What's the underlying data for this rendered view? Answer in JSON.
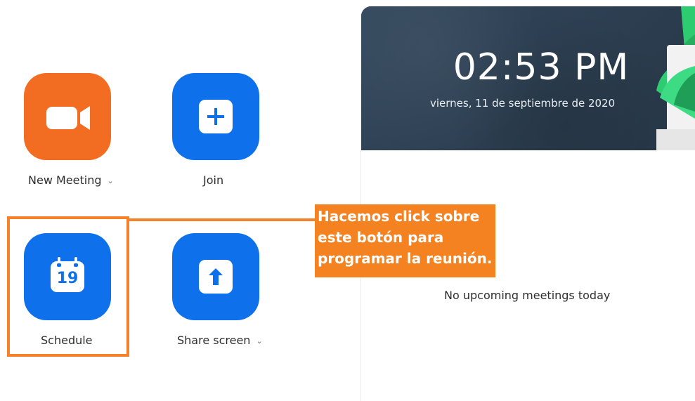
{
  "actions": {
    "new_meeting": {
      "label": "New Meeting",
      "has_dropdown": true,
      "icon": "video-camera-icon",
      "color": "#f26d21"
    },
    "join": {
      "label": "Join",
      "icon": "plus-icon",
      "color": "#0e71eb"
    },
    "schedule": {
      "label": "Schedule",
      "icon": "calendar-icon",
      "calendar_day": "19",
      "color": "#0e71eb"
    },
    "share_screen": {
      "label": "Share screen",
      "has_dropdown": true,
      "icon": "up-arrow-icon",
      "color": "#0e71eb"
    }
  },
  "clock": {
    "time": "02:53 PM",
    "date": "viernes, 11 de septiembre de 2020"
  },
  "meetings": {
    "empty_message": "No upcoming meetings today"
  },
  "annotation": {
    "callout_lines": [
      "Hacemos click sobre",
      "este botón para",
      "programar la reunión."
    ],
    "highlight_color": "#f5822a"
  }
}
